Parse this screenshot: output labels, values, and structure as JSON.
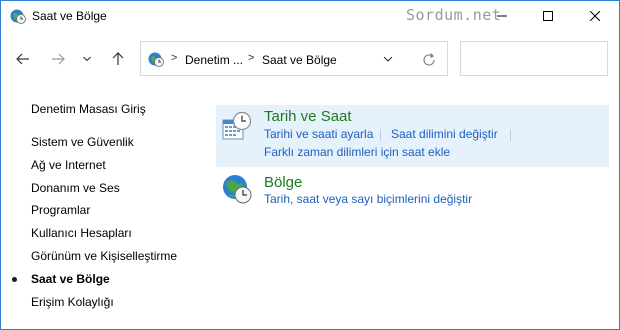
{
  "window": {
    "title": "Saat ve Bölge",
    "watermark": "Sordum.net"
  },
  "address": {
    "crumbs": [
      "Denetim ...",
      "Saat ve Bölge"
    ],
    "separator": ">"
  },
  "search": {
    "placeholder": ""
  },
  "sidebar": {
    "home": "Denetim Masası Giriş",
    "items": [
      "Sistem ve Güvenlik",
      "Ağ ve Internet",
      "Donanım ve Ses",
      "Programlar",
      "Kullanıcı Hesapları",
      "Görünüm ve Kişiselleştirme",
      "Saat ve Bölge",
      "Erişim Kolaylığı"
    ]
  },
  "categories": [
    {
      "title": "Tarih ve Saat",
      "links": [
        "Tarihi ve saati ayarla",
        "Saat dilimini değiştir",
        "Farklı zaman dilimleri için saat ekle"
      ]
    },
    {
      "title": "Bölge",
      "links": [
        "Tarih, saat veya sayı biçimlerini değiştir"
      ]
    }
  ],
  "colors": {
    "accent_border": "#2a7fd4",
    "category_title": "#1e7b1e",
    "link": "#1f5fbf",
    "highlight": "#e5f1fb"
  },
  "icons": {
    "app": "globe-clock-icon",
    "back": "arrow-left-icon",
    "forward": "arrow-right-icon",
    "recent": "chevron-down-icon",
    "up": "arrow-up-icon",
    "refresh": "refresh-icon",
    "minimize": "minimize-icon",
    "maximize": "maximize-icon",
    "close": "close-icon"
  }
}
